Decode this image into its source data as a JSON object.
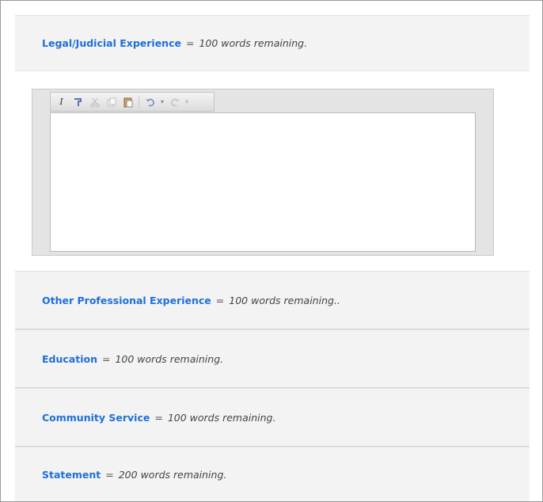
{
  "sections": [
    {
      "title": "Legal/Judicial Experience",
      "eq": "=",
      "remaining": "100 words remaining."
    },
    {
      "title": "Other Professional Experience",
      "eq": "=",
      "remaining": "100 words remaining.."
    },
    {
      "title": "Education",
      "eq": "=",
      "remaining": "100 words remaining."
    },
    {
      "title": "Community Service",
      "eq": "=",
      "remaining": "100 words remaining."
    },
    {
      "title": "Statement",
      "eq": "=",
      "remaining": "200 words remaining."
    }
  ],
  "editor": {
    "toolbar": [
      {
        "name": "italic-icon",
        "glyph": "I"
      },
      {
        "name": "format-painter-icon",
        "glyph": "⌐"
      },
      {
        "name": "cut-icon",
        "glyph": "✂"
      },
      {
        "name": "copy-icon",
        "glyph": "❐"
      },
      {
        "name": "paste-icon",
        "glyph": "📋"
      },
      {
        "name": "undo-icon",
        "glyph": "↶"
      },
      {
        "name": "undo-dropdown-icon",
        "glyph": "▾"
      },
      {
        "name": "redo-icon",
        "glyph": "↷"
      },
      {
        "name": "redo-dropdown-icon",
        "glyph": "▾"
      }
    ],
    "content": ""
  },
  "colors": {
    "title": "#1e6fd9",
    "panel_bg": "#f3f3f3"
  }
}
